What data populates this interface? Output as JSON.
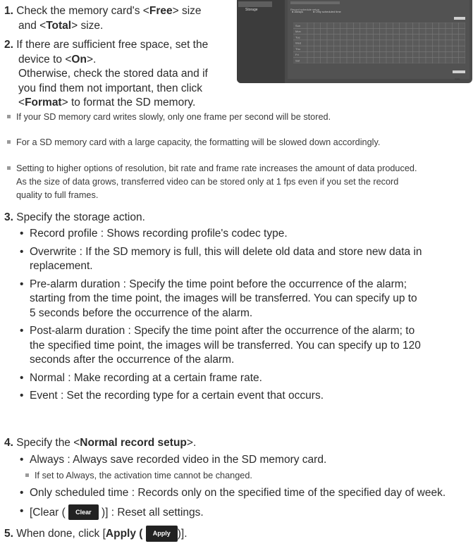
{
  "thumbnail": {
    "sidebar_label": "Storage",
    "section_title": "Record schedule setup",
    "radio_always": "Always",
    "radio_scheduled": "Only scheduled time",
    "clear_label": "Clear",
    "apply_label": "Apply",
    "days": [
      "Sun",
      "Mon",
      "Tue",
      "Wed",
      "Thu",
      "Fri",
      "Sat"
    ]
  },
  "steps": {
    "s1": {
      "num": "1.",
      "t1": "Check the memory card's <",
      "b1": "Free",
      "t2": "> size",
      "t3": "and <",
      "b2": "Total",
      "t4": "> size."
    },
    "s2": {
      "num": "2.",
      "l1": "If there are sufficient free space, set the",
      "l2a": "device to <",
      "l2b": "On",
      "l2c": ">.",
      "l3": "Otherwise, check the stored data and if",
      "l4": "you find them not important, then click",
      "l5a": "<",
      "l5b": "Format",
      "l5c": "> to format the SD memory."
    },
    "s3": {
      "num": "3.",
      "text": "Specify the storage action."
    },
    "s4": {
      "num": "4.",
      "t1": "Specify the <",
      "b1": "Normal record setup",
      "t2": ">."
    },
    "s5": {
      "num": "5.",
      "t1": "When done, click [",
      "b1": "Apply (",
      "btn": "Apply",
      "t2": ")]."
    }
  },
  "notes": {
    "n1": "If your SD memory card writes slowly, only one frame per second will be stored.",
    "n2": "For a SD memory card with a large capacity, the formatting will be slowed down accordingly.",
    "n3a": "Setting to higher options of resolution, bit rate and frame rate increases the amount of data produced.",
    "n3b": "As the size of data grows, transferred video can be stored only at 1 fps even if you set the record",
    "n3c": "quality to full frames."
  },
  "actions": {
    "b1": "Record profile : Shows recording profile's codec type.",
    "b2a": "Overwrite : If the SD memory is full, this will delete old data and store new data in",
    "b2b": "replacement.",
    "b3a": "Pre-alarm duration : Specify the time point before the occurrence of the alarm;",
    "b3b": "starting from the time point, the images will be transferred. You can specify up to",
    "b3c": "5 seconds before the occurrence of the alarm.",
    "b4a": "Post-alarm duration : Specify the time point after the occurrence of the alarm; to",
    "b4b": "the specified time point, the images will be transferred. You can specify up to 120",
    "b4c": "seconds after the occurrence of the alarm.",
    "b5": "Normal : Make recording at a certain frame rate.",
    "b6": "Event : Set the recording type for a certain event that occurs."
  },
  "normal_setup": {
    "b1": "Always : Always save recorded video in the SD memory card.",
    "note": "If set to Always, the activation time cannot be changed.",
    "b2": "Only scheduled time : Records only on the specified time of the specified day of week.",
    "b3a": "[Clear (",
    "b3btn": "Clear",
    "b3b": ")] : Reset all settings."
  }
}
